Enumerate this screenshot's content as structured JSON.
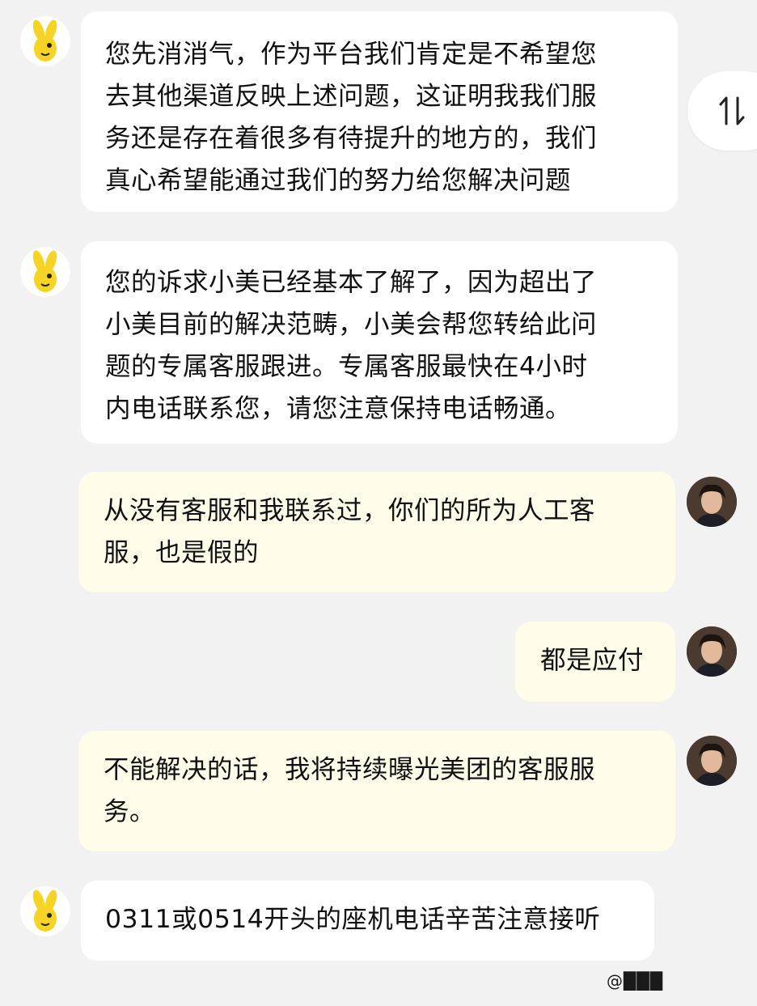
{
  "messages": [
    {
      "sender": "bot",
      "text": "您先消消气，作为平台我们肯定是不希望您\n去其他渠道反映上述问题，这证明我我们服\n务还是存在着很多有待提升的地方的，我们\n真心希望能通过我们的努力给您解决问题"
    },
    {
      "sender": "bot",
      "text": "您的诉求小美已经基本了解了，因为超出了\n小美目前的解决范畴，小美会帮您转给此问\n题的专属客服跟进。专属客服最快在4小时\n内电话联系您，请您注意保持电话畅通。"
    },
    {
      "sender": "user",
      "text": "从没有客服和我联系过，你们的所为人工客\n服，也是假的"
    },
    {
      "sender": "user",
      "text": "都是应付"
    },
    {
      "sender": "user",
      "text": "不能解决的话，我将持续曝光美团的客服服\n务。"
    },
    {
      "sender": "bot",
      "text": "0311或0514开头的座机电话辛苦注意接听"
    }
  ],
  "icons": {
    "bot_avatar": "yellow-kangaroo-mascot-icon",
    "user_avatar": "user-portrait-avatar",
    "sort": "swap-vertical-icon"
  },
  "colors": {
    "background": "#f2f2f2",
    "bot_bubble": "#ffffff",
    "user_bubble": "#fdfdea",
    "mascot_yellow": "#f6d426"
  },
  "watermark": {
    "text": "@███"
  }
}
